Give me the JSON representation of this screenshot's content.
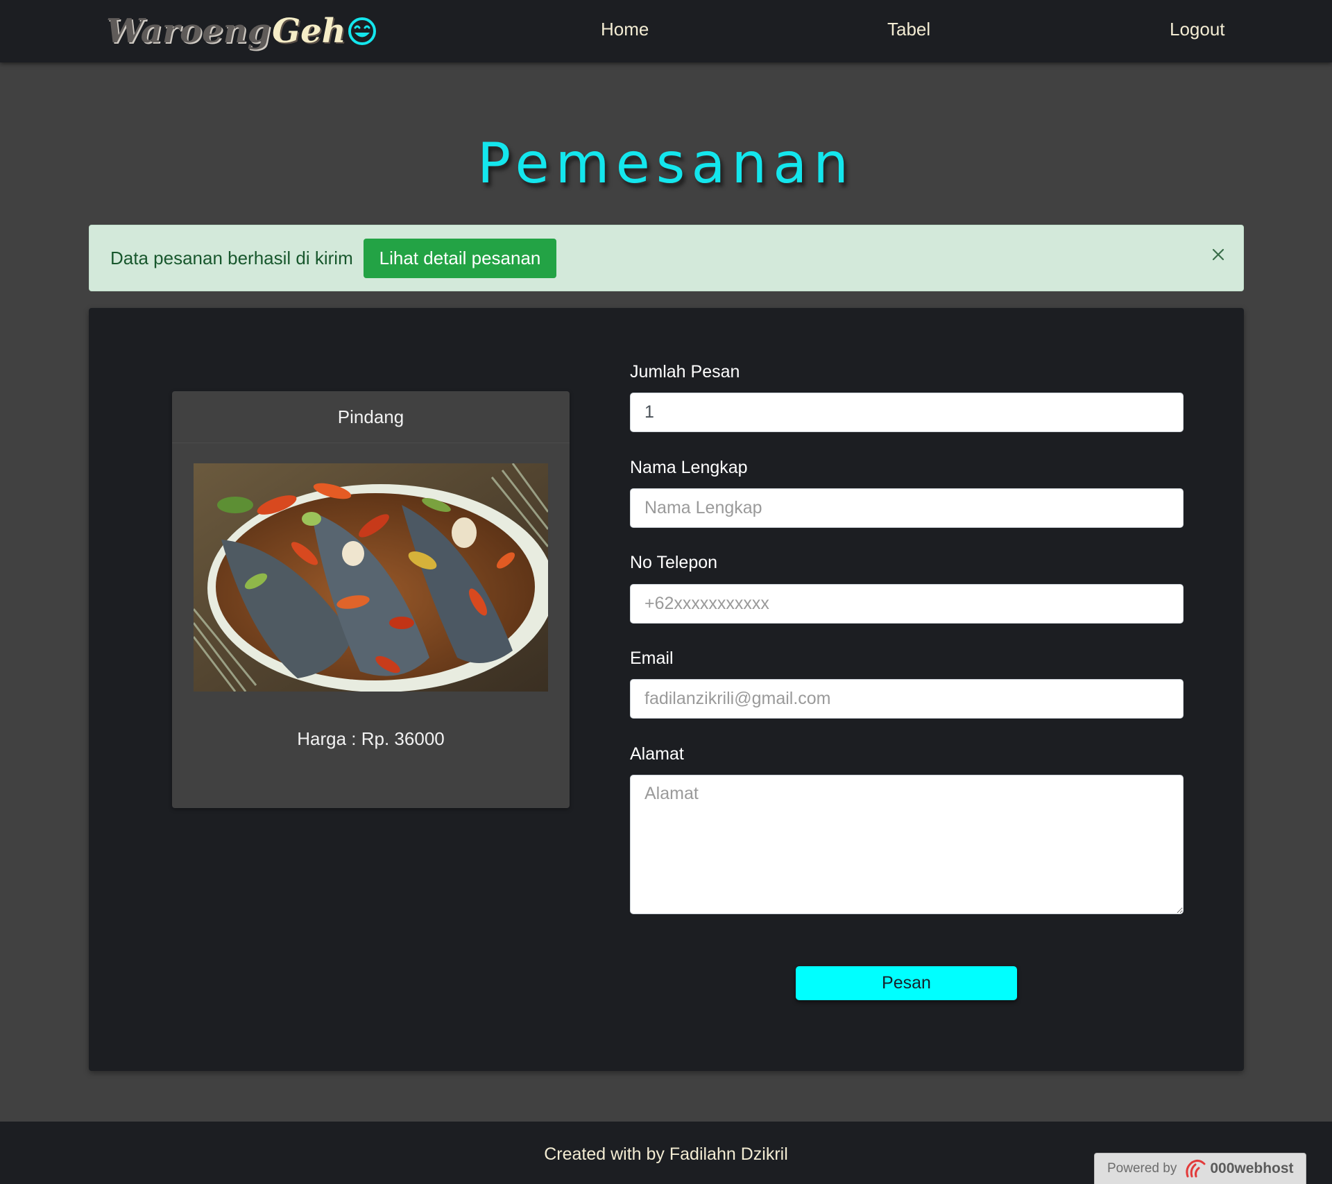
{
  "navbar": {
    "brand_part1": "Waroeng",
    "brand_part2": "Geh",
    "links": [
      "Home",
      "Tabel",
      "Logout"
    ]
  },
  "page": {
    "title": "Pemesanan"
  },
  "alert": {
    "message": "Data pesanan berhasil di kirim",
    "button_label": "Lihat detail pesanan",
    "close_symbol": "×"
  },
  "product": {
    "name": "Pindang",
    "price_text": "Harga : Rp. 36000"
  },
  "form": {
    "quantity": {
      "label": "Jumlah Pesan",
      "value": "1",
      "placeholder": ""
    },
    "name": {
      "label": "Nama Lengkap",
      "value": "",
      "placeholder": "Nama Lengkap"
    },
    "phone": {
      "label": "No Telepon",
      "value": "",
      "placeholder": "+62xxxxxxxxxxx"
    },
    "email": {
      "label": "Email",
      "value": "",
      "placeholder": "fadilanzikrili@gmail.com"
    },
    "address": {
      "label": "Alamat",
      "value": "",
      "placeholder": "Alamat"
    },
    "submit_label": "Pesan"
  },
  "footer": {
    "text": "Created with by Fadilahn Dzikril",
    "powered_by": "Powered by",
    "host_name": "000webhost"
  },
  "colors": {
    "accent": "#00ffff",
    "title": "#14e6ed",
    "navbar_bg": "#1c1e22",
    "page_bg": "#414141",
    "alert_bg": "#d3e9da",
    "alert_button": "#23a345"
  },
  "icons": [
    "smile-icon",
    "close-icon",
    "webhost-logo-icon"
  ]
}
